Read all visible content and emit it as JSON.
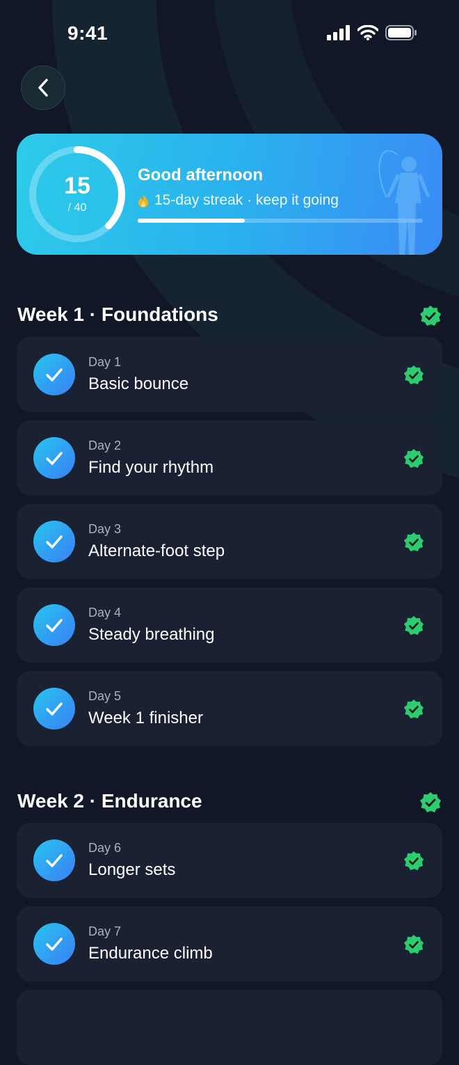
{
  "status_bar": {
    "time": "9:41"
  },
  "hero": {
    "completed_days": "15",
    "total_days": "/ 40",
    "progress_fraction": 0.375,
    "greeting": "Good afternoon",
    "streak_text": "15-day streak · keep it going"
  },
  "weeks": [
    {
      "title": "Week 1 · Foundations",
      "completed": true,
      "days": [
        {
          "label": "Day 1",
          "title": "Basic bounce",
          "completed": true
        },
        {
          "label": "Day 2",
          "title": "Find your rhythm",
          "completed": true
        },
        {
          "label": "Day 3",
          "title": "Alternate-foot step",
          "completed": true
        },
        {
          "label": "Day 4",
          "title": "Steady breathing",
          "completed": true
        },
        {
          "label": "Day 5",
          "title": "Week 1 finisher",
          "completed": true
        }
      ]
    },
    {
      "title": "Week 2 · Endurance",
      "completed": true,
      "days": [
        {
          "label": "Day 6",
          "title": "Longer sets",
          "completed": true
        },
        {
          "label": "Day 7",
          "title": "Endurance climb",
          "completed": true
        }
      ]
    }
  ],
  "colors": {
    "background": "#111726",
    "card": "#1a2132",
    "accent_start": "#27c5f0",
    "accent_end": "#3b7ff4",
    "badge_green": "#2ecc71"
  },
  "icons": {
    "back": "chevron-left-icon",
    "day_check": "checkmark-icon",
    "badge": "verified-badge-icon",
    "streak": "flame-icon"
  }
}
